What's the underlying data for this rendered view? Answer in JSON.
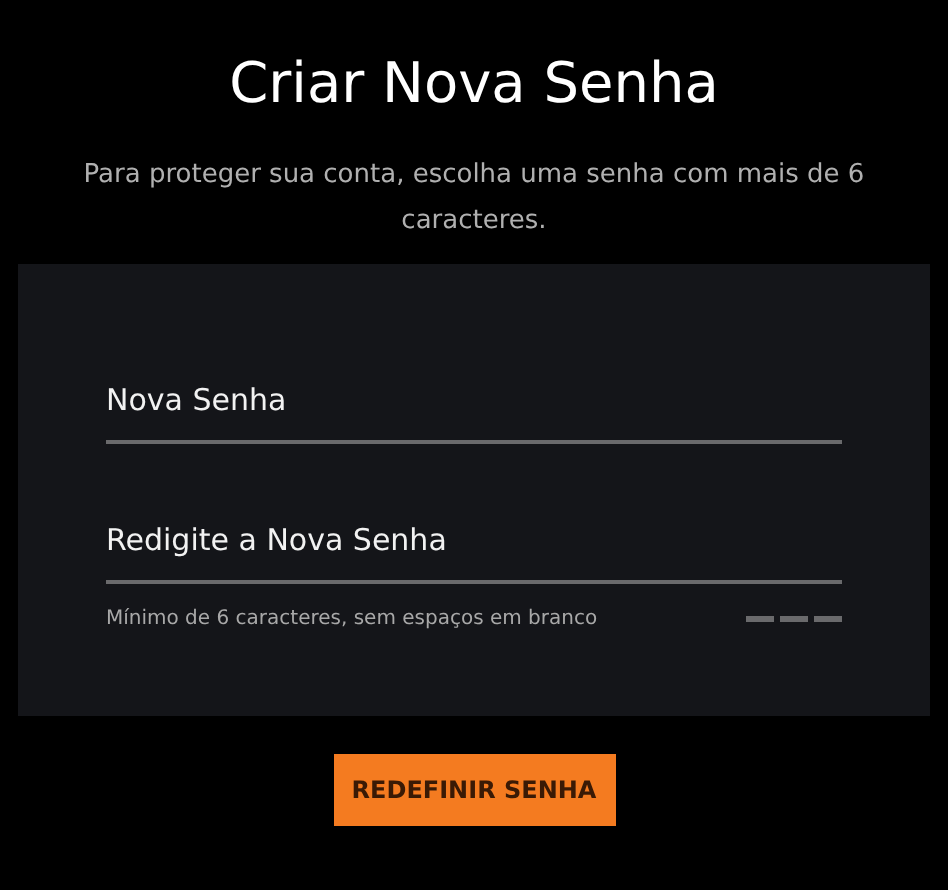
{
  "title": "Criar Nova Senha",
  "subtitle": "Para proteger sua conta, escolha uma senha com mais de 6 caracteres.",
  "fields": [
    {
      "placeholder": "Nova Senha"
    },
    {
      "placeholder": "Redigite a Nova Senha"
    }
  ],
  "hint": "Mínimo de 6 caracteres, sem espaços em branco",
  "strength_meter": {
    "level": 0
  },
  "button": "REDEFINIR SENHA"
}
